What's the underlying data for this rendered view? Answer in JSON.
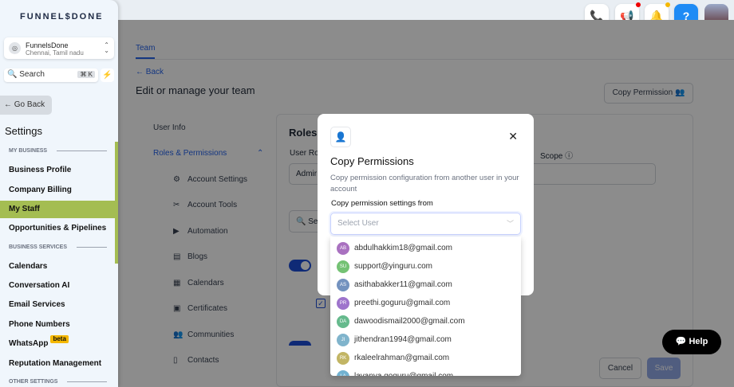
{
  "brand": "FUNNEL$DONE",
  "location": {
    "name": "FunnelsDone",
    "address": "Chennai, Tamil nadu"
  },
  "search": {
    "label": "Search",
    "shortcut": "⌘ K"
  },
  "go_back": "Go Back",
  "settings_title": "Settings",
  "sidebar": {
    "sections": [
      "MY BUSINESS",
      "BUSINESS SERVICES",
      "OTHER SETTINGS"
    ],
    "items": [
      "Business Profile",
      "Company Billing",
      "My Staff",
      "Opportunities & Pipelines",
      "Calendars",
      "Conversation AI",
      "Email Services",
      "Phone Numbers",
      "WhatsApp",
      "Reputation Management"
    ],
    "beta_label": "beta"
  },
  "topbar": {
    "help_label": "?"
  },
  "main": {
    "tab": "Team",
    "back": "Back",
    "title": "Edit or manage your team",
    "copy_permission": "Copy Permission",
    "nav": {
      "user_info": "User Info",
      "roles": "Roles & Permissions"
    },
    "subitems": [
      "Account Settings",
      "Account Tools",
      "Automation",
      "Blogs",
      "Calendars",
      "Certificates",
      "Communities",
      "Contacts"
    ],
    "panel": {
      "title": "Roles",
      "user_role_label": "User Ro",
      "role_value": "Admir",
      "scope_label": "Scope",
      "search_placeholder": "Se"
    },
    "cancel": "Cancel",
    "save": "Save"
  },
  "modal": {
    "title": "Copy Permissions",
    "description": "Copy permission configuration from another user in your account",
    "field_label": "Copy permission settings from",
    "placeholder": "Select User",
    "users": [
      {
        "initials": "AB",
        "email": "abdulhakkim18@gmail.com",
        "color": "#9b59b6"
      },
      {
        "initials": "SU",
        "email": "support@yinguru.com",
        "color": "#5cb85c"
      },
      {
        "initials": "AS",
        "email": "asithabakker11@gmail.com",
        "color": "#5b7fb5"
      },
      {
        "initials": "PR",
        "email": "preethi.goguru@gmail.com",
        "color": "#8e5cc4"
      },
      {
        "initials": "DA",
        "email": "dawoodismail2000@gmail.com",
        "color": "#4caf7a"
      },
      {
        "initials": "JI",
        "email": "jithendran1994@gmail.com",
        "color": "#6aa7c4"
      },
      {
        "initials": "RK",
        "email": "rkaleelrahman@gmail.com",
        "color": "#b8a94a"
      },
      {
        "initials": "LA",
        "email": "lavanya.goguru@gmail.com",
        "color": "#5aa5c9"
      }
    ]
  },
  "help_widget": "Help"
}
